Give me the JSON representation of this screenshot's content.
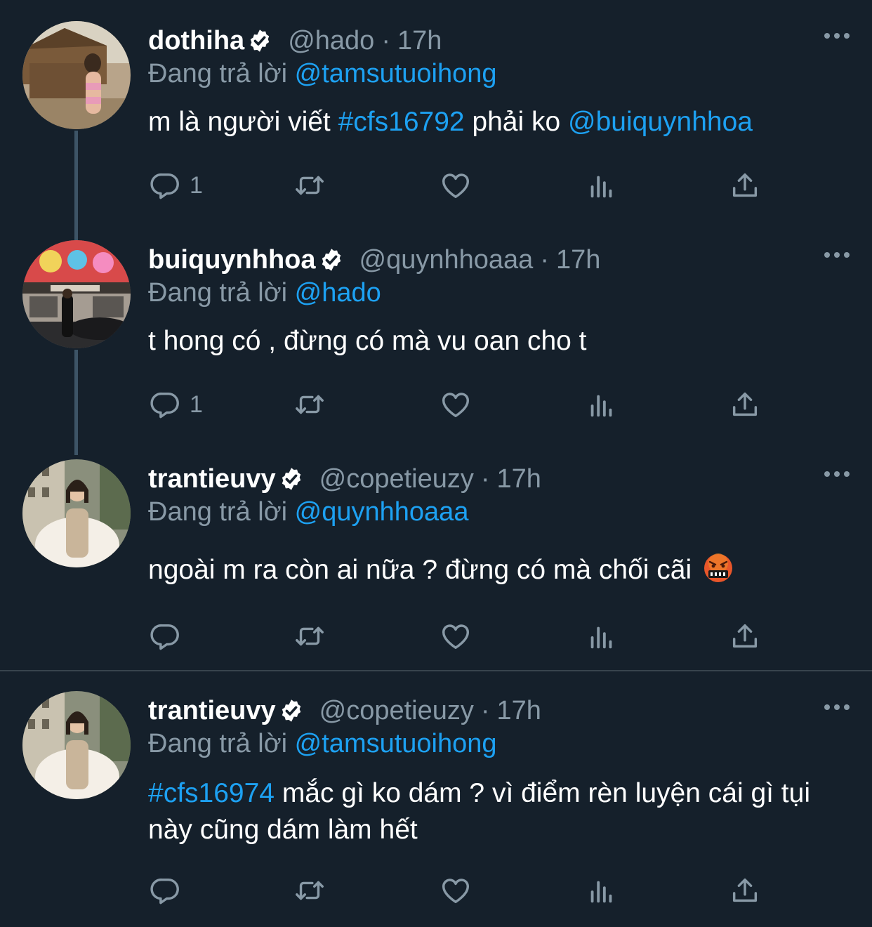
{
  "tweets": [
    {
      "name": "dothiha",
      "handle": "@hado",
      "time": "17h",
      "replying_label": "Đang trả lời",
      "replying_to": "@tamsutuoihong",
      "content_parts": [
        {
          "text": "m là người viết ",
          "link": false
        },
        {
          "text": "#cfs16792",
          "link": true
        },
        {
          "text": " phải ko ",
          "link": false
        },
        {
          "text": "@buiquynhhoa",
          "link": true
        }
      ],
      "reply_count": "1",
      "avatar_icon": "avatar-photo-woman-bikini"
    },
    {
      "name": "buiquynhhoa",
      "handle": "@quynhhoaaa",
      "time": "17h",
      "replying_label": "Đang trả lời",
      "replying_to": "@hado",
      "content_parts": [
        {
          "text": "t hong có , đừng có mà vu oan cho t",
          "link": false
        }
      ],
      "reply_count": "1",
      "avatar_icon": "avatar-photo-street-storefront"
    },
    {
      "name": "trantieuvy",
      "handle": "@copetieuzy",
      "time": "17h",
      "replying_label": "Đang trả lời",
      "replying_to": "@quynhhoaaa",
      "content_parts": [
        {
          "text": "ngoài m ra còn ai nữa ? đừng có mà chối cãi ",
          "link": false
        }
      ],
      "content_emoji": "angry-cursing-face-emoji",
      "reply_count": "",
      "avatar_icon": "avatar-photo-woman-white-fur"
    },
    {
      "name": "trantieuvy",
      "handle": "@copetieuzy",
      "time": "17h",
      "replying_label": "Đang trả lời",
      "replying_to": "@tamsutuoihong",
      "content_parts": [
        {
          "text": "#cfs16974",
          "link": true
        },
        {
          "text": " mắc gì ko dám ? vì điểm rèn luyện cái gì tụi này cũng dám làm hết",
          "link": false
        }
      ],
      "reply_count": "",
      "avatar_icon": "avatar-photo-woman-white-fur"
    }
  ],
  "colors": {
    "background": "#15202b",
    "secondary_text": "#8899a6",
    "link": "#1da1f2",
    "thread_line": "#3d5466",
    "divider": "#38444d"
  },
  "icons": {
    "verified": "verified-badge-icon",
    "more": "more-options-icon",
    "reply": "reply-icon",
    "retweet": "retweet-icon",
    "like": "like-icon",
    "analytics": "analytics-icon",
    "share": "share-icon"
  }
}
